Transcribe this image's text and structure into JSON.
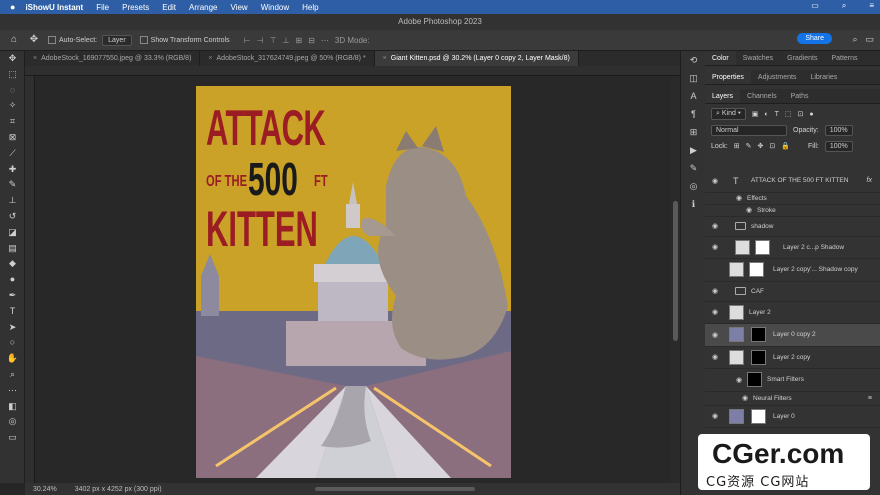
{
  "menubar": {
    "app": "iShowU Instant",
    "items": [
      "File",
      "Presets",
      "Edit",
      "Arrange",
      "View",
      "Window",
      "Help"
    ]
  },
  "window_title": "Adobe Photoshop 2023",
  "options": {
    "auto_select_label": "Auto-Select:",
    "auto_select_value": "Layer",
    "show_transform_label": "Show Transform Controls",
    "mode_3d": "3D Mode:",
    "share_label": "Share"
  },
  "doc_tabs": [
    {
      "label": "AdobeStock_169077550.jpeg @ 33.3% (RGB/8)"
    },
    {
      "label": "AdobeStock_317624749.jpeg @ 50% (RGB/8) *"
    },
    {
      "label": "Giant Kitten.psd @ 30.2% (Layer 0 copy 2, Layer Mask/8)"
    }
  ],
  "poster": {
    "line1": "ATTACK",
    "of_the": "OF THE",
    "number": "500",
    "ft": "FT",
    "line3": "KITTEN"
  },
  "status": {
    "zoom": "30.24%",
    "size": "3402 px x 4252 px (300 ppi)"
  },
  "panel_tabs_top": [
    "Color",
    "Swatches",
    "Gradients",
    "Patterns"
  ],
  "panel_tabs_mid": [
    "Properties",
    "Adjustments",
    "Libraries"
  ],
  "panel_tabs_layers": [
    "Layers",
    "Channels",
    "Paths"
  ],
  "layers_panel": {
    "kind": "Kind",
    "blend_mode": "Normal",
    "opacity_label": "Opacity:",
    "opacity_value": "100%",
    "lock_label": "Lock:",
    "fill_label": "Fill:",
    "fill_value": "100%"
  },
  "layers": [
    {
      "name": "ATTACK OF THE 500 FT KITTEN",
      "kind": "text",
      "fx": "fx"
    },
    {
      "name": "Effects",
      "kind": "sub1"
    },
    {
      "name": "Stroke",
      "kind": "sub2"
    },
    {
      "name": "shadow",
      "kind": "group"
    },
    {
      "name": "Layer 2 c...p Shadow",
      "kind": "masked"
    },
    {
      "name": "Layer 2 copy'... Shadow copy",
      "kind": "masked2"
    },
    {
      "name": "CAF",
      "kind": "group"
    },
    {
      "name": "Layer 2",
      "kind": "plain"
    },
    {
      "name": "Layer 0 copy 2",
      "kind": "masked",
      "selected": true
    },
    {
      "name": "Layer 2 copy",
      "kind": "masked"
    },
    {
      "name": "Smart Filters",
      "kind": "sub2"
    },
    {
      "name": "Neural Filters",
      "kind": "sub1"
    },
    {
      "name": "Layer 0",
      "kind": "masked"
    }
  ],
  "watermark": {
    "big": "CGer.com",
    "small": "CG资源 CG网站"
  },
  "colors": {
    "poster_bg": "#c9a227",
    "title_red": "#9b1c22",
    "accent_blue": "#1473e6"
  }
}
